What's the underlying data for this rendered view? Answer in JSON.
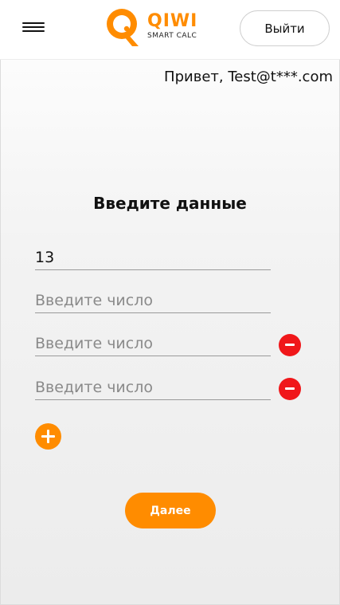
{
  "header": {
    "logo": {
      "title": "QIWI",
      "subtitle": "SMART CALC",
      "brand_color": "#ff8c00"
    },
    "menu_icon": "hamburger-menu-icon",
    "logout_label": "Выйти"
  },
  "greeting": "Привет, Test@t***.com",
  "form": {
    "title": "Введите данные",
    "fields": [
      {
        "value": "13",
        "placeholder": "Введите число",
        "removable": false
      },
      {
        "value": "",
        "placeholder": "Введите число",
        "removable": false
      },
      {
        "value": "",
        "placeholder": "Введите число",
        "removable": true
      },
      {
        "value": "",
        "placeholder": "Введите число",
        "removable": true
      }
    ],
    "add_icon": "plus-circle-icon",
    "remove_icon": "minus-circle-icon",
    "remove_color": "#f0171a",
    "next_label": "Далее"
  }
}
